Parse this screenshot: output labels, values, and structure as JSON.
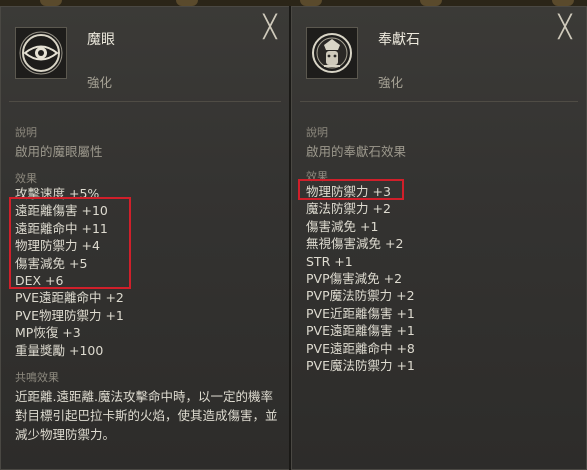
{
  "left": {
    "icon": "eye-emblem-icon",
    "title": "魔眼",
    "subtitle": "強化",
    "desc_label": "說明",
    "desc_text": "啟用的魔眼屬性",
    "effect_label": "效果",
    "effects": [
      "攻擊速度 +5%",
      "遠距離傷害 +10",
      "遠距離命中 +11",
      "物理防禦力 +4",
      "傷害減免 +5",
      "DEX +6",
      "PVE遠距離命中 +2",
      "PVE物理防禦力 +1",
      "MP恢復 +3",
      "重量獎勵 +100"
    ],
    "synergy_label": "共鳴效果",
    "synergy_text": "近距離.遠距離.魔法攻擊命中時，以一定的機率對目標引起巴拉卡斯的火焰，使其造成傷害，並減少物理防禦力。"
  },
  "right": {
    "icon": "offering-stone-icon",
    "title": "奉獻石",
    "subtitle": "強化",
    "desc_label": "說明",
    "desc_text": "啟用的奉獻石效果",
    "effect_label": "效果",
    "effects": [
      "物理防禦力 +3",
      "魔法防禦力 +2",
      "傷害減免 +1",
      "無視傷害減免 +2",
      "STR +1",
      "PVP傷害減免 +2",
      "PVP魔法防禦力 +2",
      "PVE近距離傷害 +1",
      "PVE遠距離傷害 +1",
      "PVE遠距離命中 +8",
      "PVE魔法防禦力 +1"
    ]
  },
  "close_glyph": "╳",
  "highlight_color": "#d01f2a"
}
